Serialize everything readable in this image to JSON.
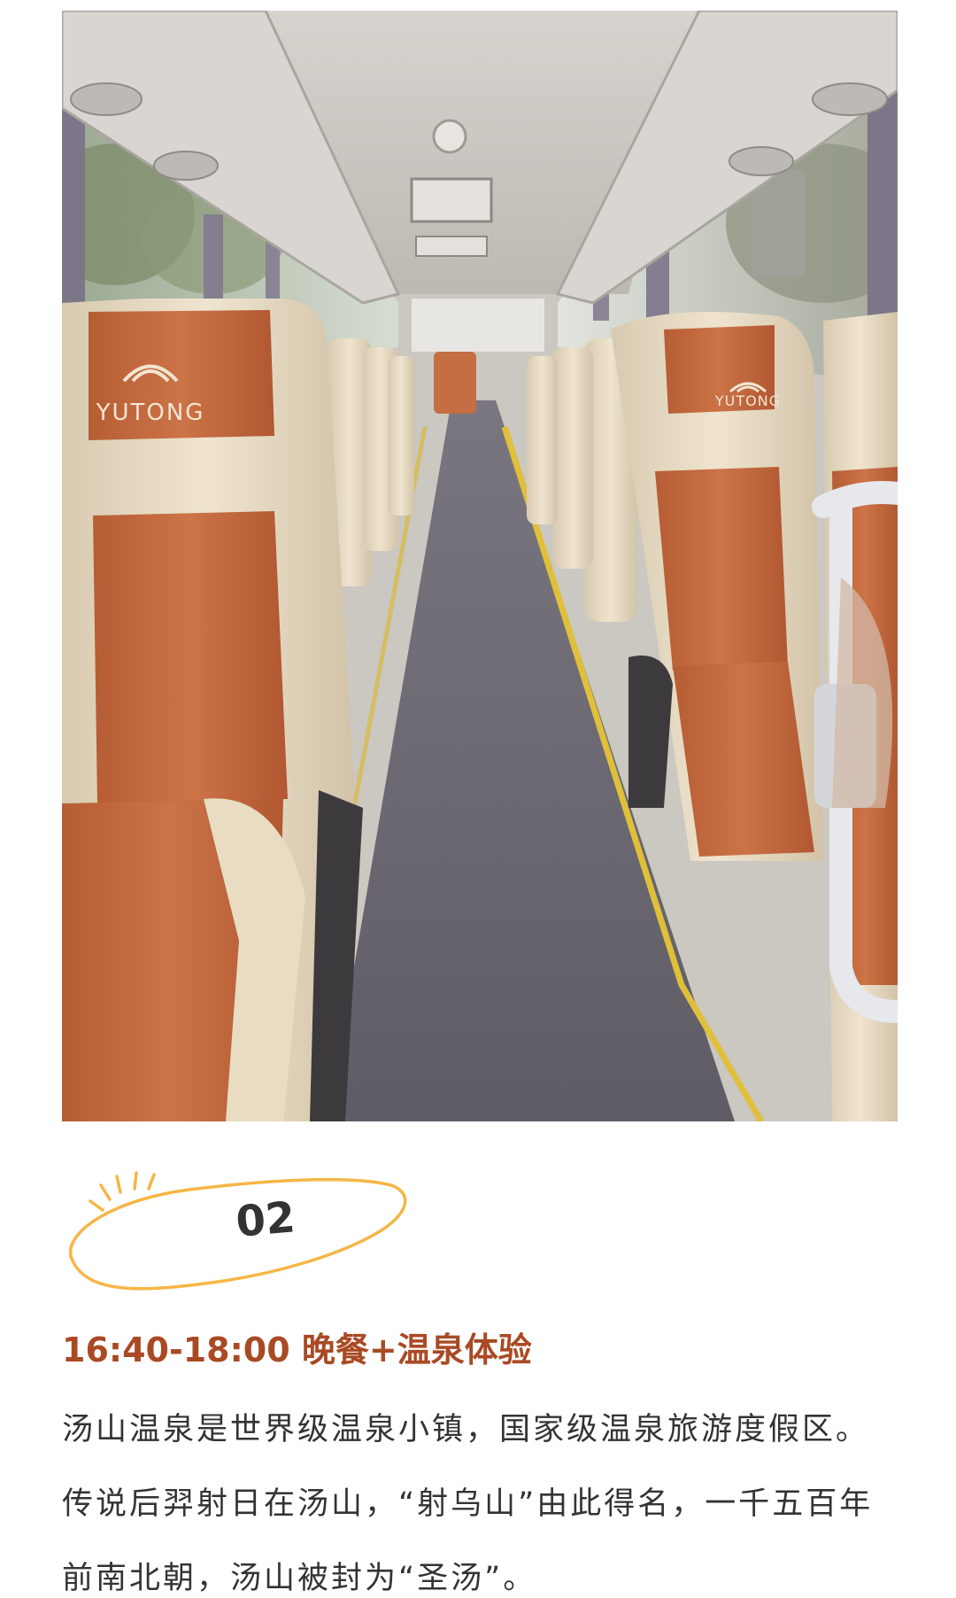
{
  "image": {
    "brand_logo_text_left": "YUTONG",
    "brand_logo_text_right": "YUTONG",
    "colors": {
      "seat_orange": "#c76b3f",
      "seat_cream": "#e9dcc3",
      "aisle_gray": "#6b6870",
      "yellow_stripe": "#e0bf3a",
      "ceiling": "#cfcbc6"
    }
  },
  "badge": {
    "number": "02",
    "outline_color": "#f5b646"
  },
  "section": {
    "title": "16:40-18:00 晚餐+温泉体验",
    "title_color": "#a94a24",
    "paragraph": "汤山温泉是世界级温泉小镇，国家级温泉旅游度假区。传说后羿射日在汤山，“射乌山”由此得名，一千五百年前南北朝，汤山被封为“圣汤”。"
  }
}
